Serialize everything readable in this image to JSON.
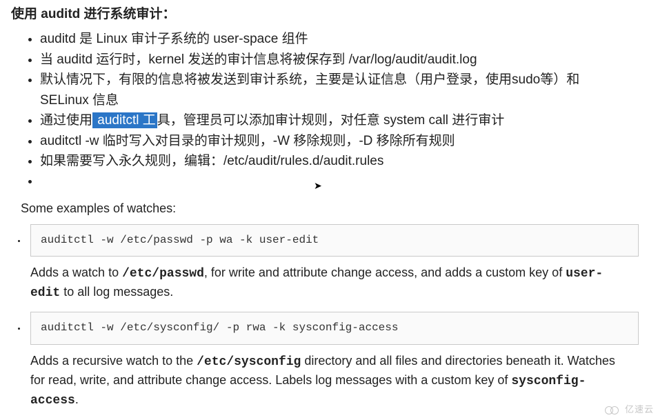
{
  "heading": "使用 auditd 进行系统审计：",
  "bullets": [
    {
      "pre": "auditd 是 Linux 审计子系统的 user-space 组件"
    },
    {
      "pre": "当 auditd 运行时，kernel 发送的审计信息将被保存到 /var/log/audit/audit.log"
    },
    {
      "pre": "默认情况下，有限的信息将被发送到审计系统，主要是认证信息（用户登录，使用sudo等）和 SELinux 信息"
    },
    {
      "pre": "通过使用",
      "highlight": " auditctl 工",
      "post": "具，管理员可以添加审计规则，对任意 system call 进行审计"
    },
    {
      "pre": "auditctl -w 临时写入对目录的审计规则，-W 移除规则，-D 移除所有规则"
    },
    {
      "pre": "如果需要写入永久规则，编辑：/etc/audit/rules.d/audit.rules"
    },
    {
      "pre": ""
    }
  ],
  "examples_label": "Some examples of watches:",
  "examples": [
    {
      "code": "auditctl -w /etc/passwd -p wa -k user-edit",
      "desc_pre": "Adds a watch to ",
      "desc_mono1": "/etc/passwd",
      "desc_mid": ", for write and attribute change access, and adds a custom key of ",
      "desc_mono2": "user-edit",
      "desc_post": " to all log messages."
    },
    {
      "code": "auditctl -w /etc/sysconfig/ -p rwa -k sysconfig-access",
      "desc_pre": "Adds a recursive watch to the ",
      "desc_mono1": "/etc/sysconfig",
      "desc_mid": " directory and all files and directories beneath it. Watches for read, write, and attribute change access. Labels log messages with a custom key of ",
      "desc_mono2": "sysconfig-access",
      "desc_post": "."
    }
  ],
  "watermark": "亿速云"
}
